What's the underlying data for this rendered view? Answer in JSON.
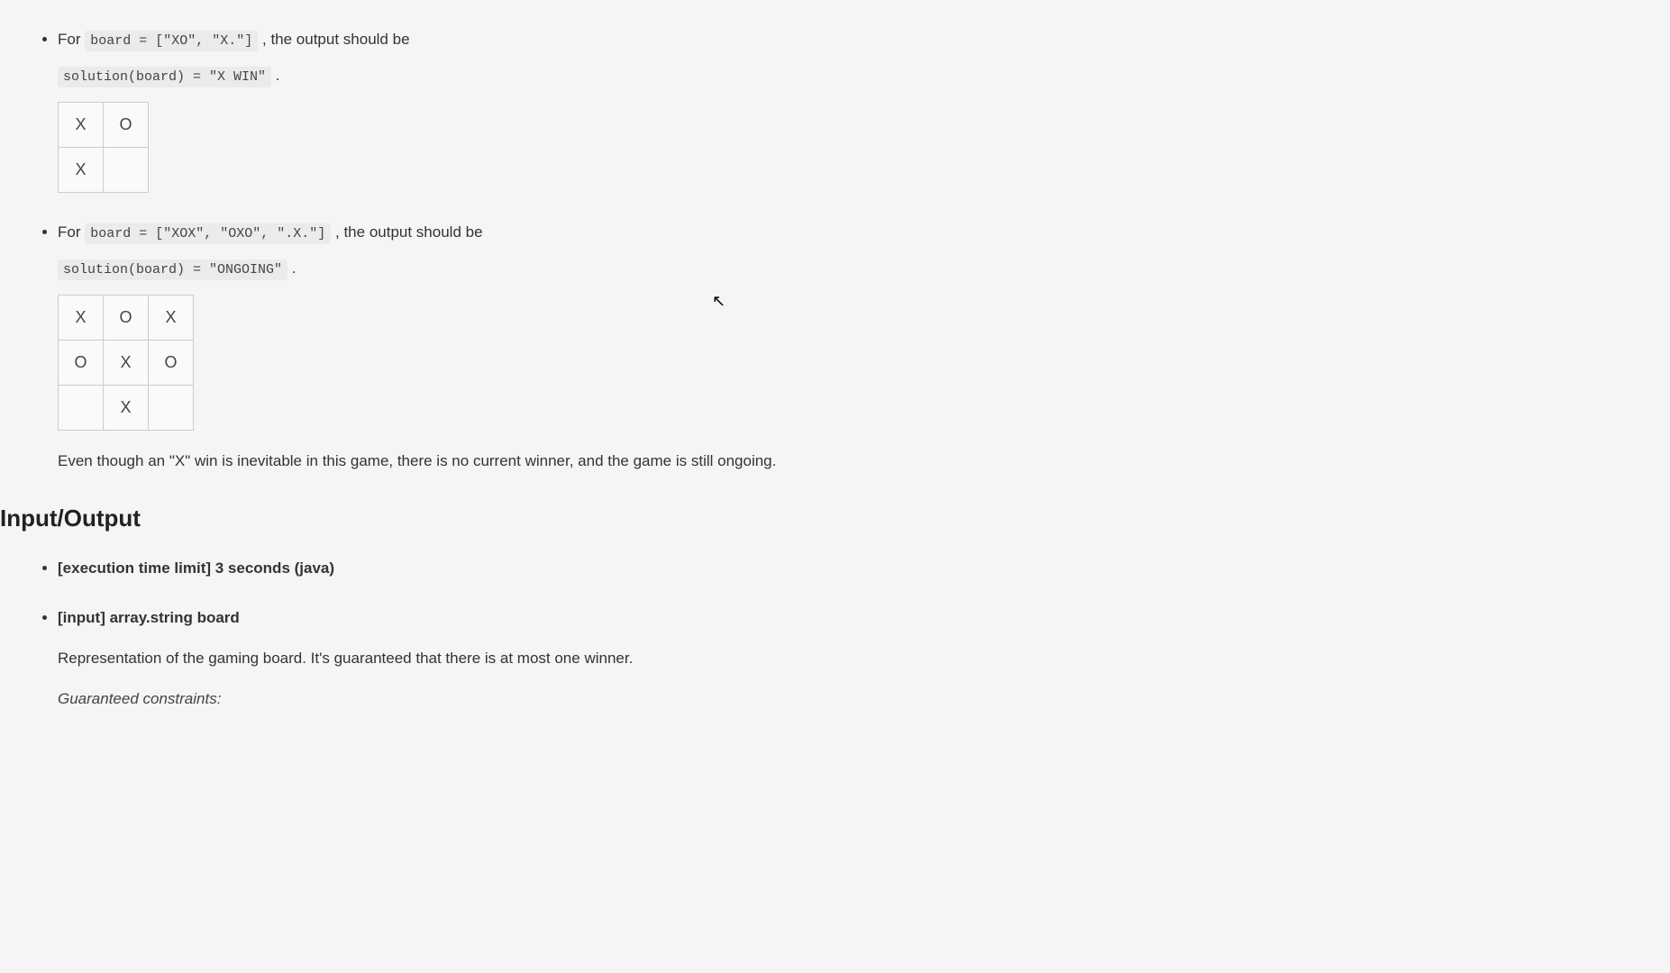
{
  "example1": {
    "prefix": "For ",
    "code_board": "board = [\"XO\", \"X.\"]",
    "suffix": " , the output should be",
    "code_solution": "solution(board) = \"X WIN\"",
    "period": " .",
    "grid": [
      [
        "X",
        "O"
      ],
      [
        "X",
        ""
      ]
    ]
  },
  "example2": {
    "prefix": "For ",
    "code_board": "board = [\"XOX\", \"OXO\", \".X.\"]",
    "suffix": " , the output should be",
    "code_solution": "solution(board) = \"ONGOING\"",
    "period": " .",
    "grid": [
      [
        "X",
        "O",
        "X"
      ],
      [
        "O",
        "X",
        "O"
      ],
      [
        "",
        "X",
        ""
      ]
    ],
    "explanation": "Even though an \"X\" win is inevitable in this game, there is no current winner, and the game is still ongoing."
  },
  "io_heading": "Input/Output",
  "io_items": {
    "time_limit": "[execution time limit] 3 seconds (java)",
    "input_label": "[input] array.string board",
    "input_desc": "Representation of the gaming board. It's guaranteed that there is at most one winner.",
    "constraints_label": "Guaranteed constraints:"
  }
}
